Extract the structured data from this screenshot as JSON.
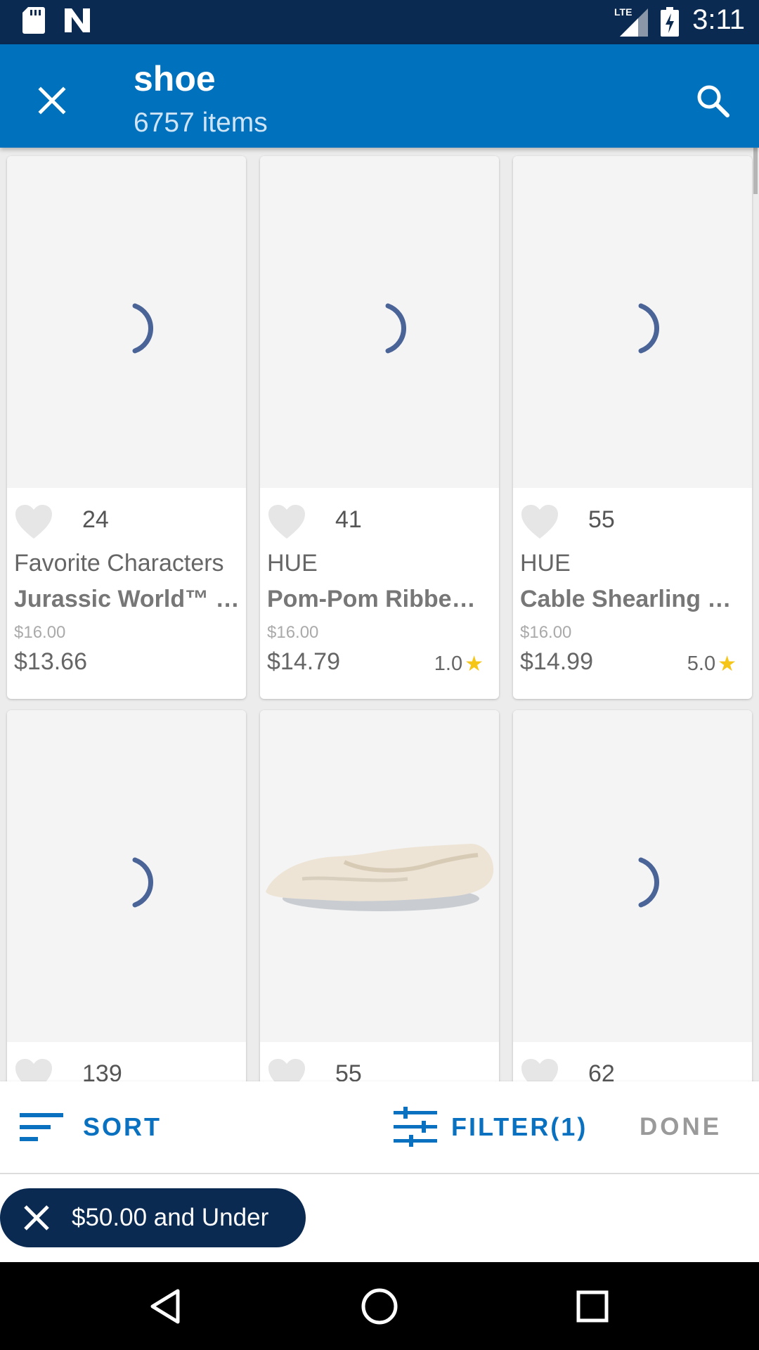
{
  "status_bar": {
    "time": "3:11",
    "network_label": "LTE",
    "icons": [
      "sd-card-icon",
      "n-notification-icon",
      "lte-signal-icon",
      "battery-charging-icon"
    ]
  },
  "app_bar": {
    "title": "shoe",
    "subtitle": "6757 items",
    "close_icon": "close-icon",
    "search_icon": "search-icon",
    "bg_color": "#0071bc"
  },
  "products": [
    {
      "fav_count": "24",
      "brand": "Favorite Characters",
      "name": "Jurassic World™ …",
      "old_price": "$16.00",
      "price": "$13.66",
      "rating": "",
      "image": "loading"
    },
    {
      "fav_count": "41",
      "brand": "HUE",
      "name": "Pom-Pom Ribbe…",
      "old_price": "$16.00",
      "price": "$14.79",
      "rating": "1.0",
      "image": "loading"
    },
    {
      "fav_count": "55",
      "brand": "HUE",
      "name": "Cable Shearling …",
      "old_price": "$16.00",
      "price": "$14.99",
      "rating": "5.0",
      "image": "loading"
    },
    {
      "fav_count": "139",
      "image": "loading"
    },
    {
      "fav_count": "55",
      "image": "slipper-photo"
    },
    {
      "fav_count": "62",
      "image": "loading"
    }
  ],
  "toolbar": {
    "sort_label": "SORT",
    "filter_label": "FILTER(1)",
    "done_label": "DONE",
    "accent": "#0a71c0"
  },
  "chips": [
    {
      "label": "$50.00 and Under"
    }
  ],
  "nav": {
    "icons": [
      "back-icon",
      "home-icon",
      "recents-icon"
    ]
  }
}
